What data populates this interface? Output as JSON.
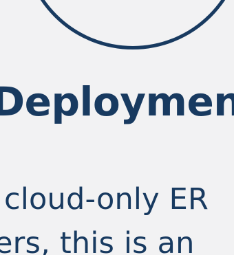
{
  "feature_card": {
    "icon_name": "deployment-icon",
    "title": "Deployment",
    "body_lines": [
      "cloud-only ER",
      "ers, this is an"
    ]
  },
  "colors": {
    "background": "#f2f2f3",
    "text": "#183a60",
    "icon_stroke": "#183a60"
  }
}
